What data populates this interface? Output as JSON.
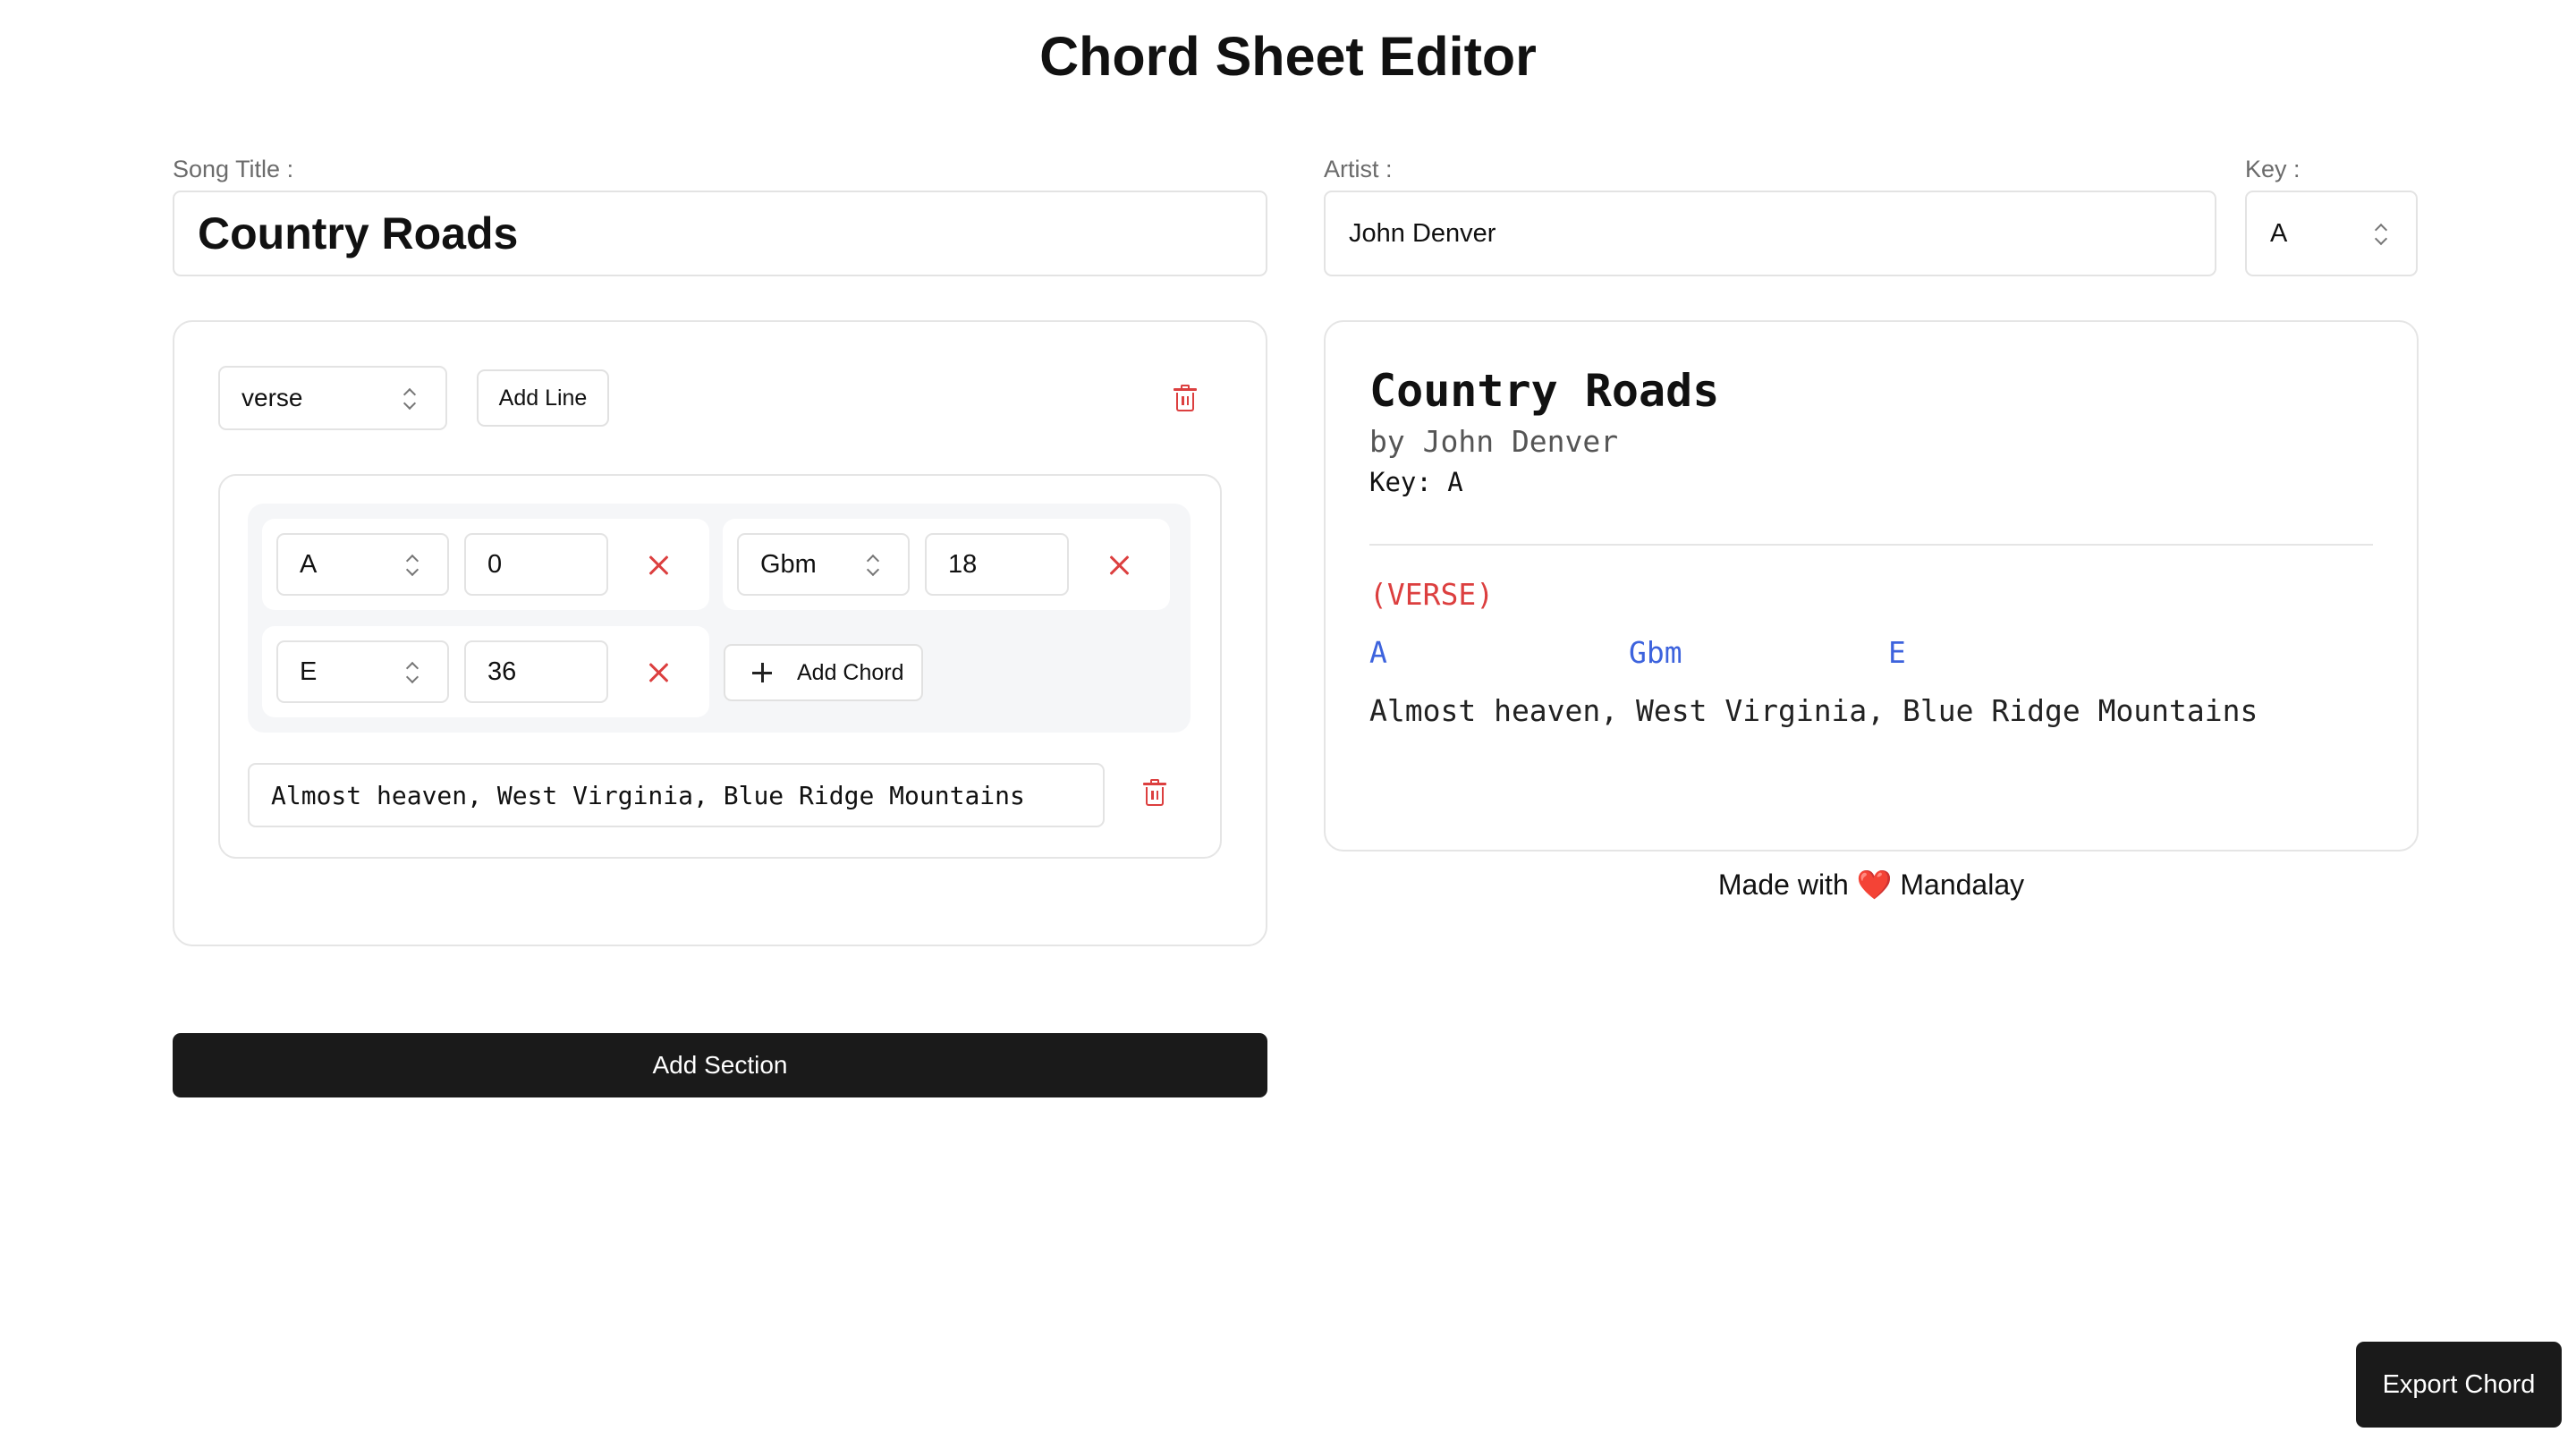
{
  "header": {
    "title": "Chord Sheet Editor"
  },
  "song": {
    "title_label": "Song Title :",
    "title_value": "Country Roads",
    "artist_label": "Artist :",
    "artist_value": "John Denver",
    "key_label": "Key :",
    "key_value": "A"
  },
  "editor": {
    "section_type": "verse",
    "add_line_label": "Add Line",
    "chords": [
      {
        "name": "A",
        "position": "0"
      },
      {
        "name": "Gbm",
        "position": "18"
      },
      {
        "name": "E",
        "position": "36"
      }
    ],
    "add_chord_label": "Add Chord",
    "lyric": "Almost heaven, West Virginia, Blue Ridge Mountains",
    "add_section_label": "Add Section"
  },
  "preview": {
    "title": "Country Roads",
    "artist": "by John Denver",
    "key": "Key: A",
    "section_label": "(VERSE)",
    "chords": [
      "A",
      "Gbm",
      "E"
    ],
    "lyric": "Almost heaven, West Virginia, Blue Ridge Mountains"
  },
  "footer": {
    "prefix": "Made with",
    "heart": "❤️",
    "suffix": "Mandalay"
  },
  "export_label": "Export Chord",
  "colors": {
    "accent_red": "#dc3f3f",
    "chord_blue": "#3d63dd",
    "dark": "#1a1a1a"
  }
}
